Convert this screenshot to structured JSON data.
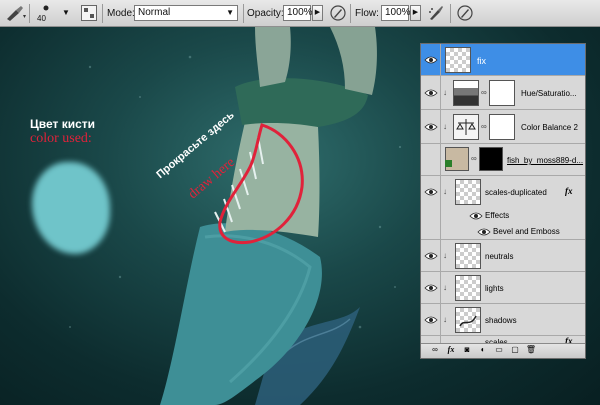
{
  "options_bar": {
    "brush_size": "40",
    "mode_label": "Mode:",
    "mode_value": "Normal",
    "opacity_label": "Opacity:",
    "opacity_value": "100%",
    "flow_label": "Flow:",
    "flow_value": "100%"
  },
  "canvas": {
    "brush_label_ru": "Цвет кисти",
    "brush_label_en": "color used:",
    "draw_label_ru": "Прокрасьте здесь",
    "draw_label_en": "draw here",
    "brush_color": "#6fc4c9",
    "highlight_color": "#e0223a"
  },
  "layers": [
    {
      "name": "fix",
      "selected": true
    },
    {
      "name": "Hue/Saturatio..."
    },
    {
      "name": "Color Balance 2"
    },
    {
      "name": "fish_by_moss889-d..."
    },
    {
      "name": "scales-duplicated"
    },
    {
      "name": "Effects"
    },
    {
      "name": "Bevel and Emboss"
    },
    {
      "name": "neutrals"
    },
    {
      "name": "lights"
    },
    {
      "name": "shadows"
    },
    {
      "name": "scales"
    }
  ],
  "layer_fx_symbol": "fx",
  "icons": {
    "brush": "brush-icon",
    "airbrush": "airbrush-icon",
    "visibility": "eye-icon"
  }
}
